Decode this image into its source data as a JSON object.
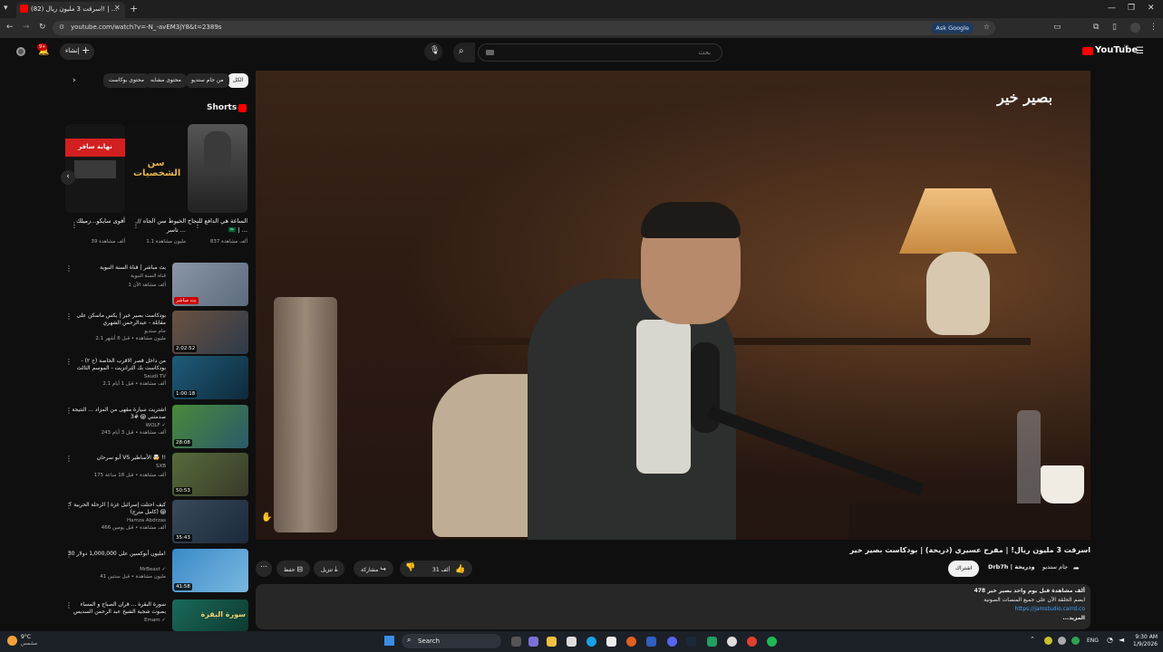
{
  "browser": {
    "tab_title": "(82) اسرقت 3 مليون ريال! | ...",
    "url": "youtube.com/watch?v=-N_-avEM3jY8&t=2389s",
    "ask_google": "Ask Google"
  },
  "header": {
    "logo": "YouTube",
    "logo_sup": "SA",
    "search_placeholder": "بحث",
    "create_label": "إنشاء",
    "notifications_count": "9+"
  },
  "filter_chips": [
    "الكل",
    "من جام ستديو",
    "محتوى مشابه",
    "محتوى بوكاست"
  ],
  "shorts": {
    "heading": "Shorts",
    "items": [
      {
        "title": "الساعة هي الدافع للنجاح 🇸🇦 | ...",
        "views": "837 ألف مشاهدة"
      },
      {
        "title": "الخيوط سن الجاه // تاسر ...",
        "views": "1.1 مليون مشاهدة",
        "overlay": "سن الشخصيات"
      },
      {
        "title": "أقوى سايكو...زميلك",
        "views": "39 ألف مشاهدة",
        "overlay": "نهاية سافر"
      }
    ]
  },
  "related": [
    {
      "title": "بث مباشر | قناة السنة النبوية",
      "channel": "قناة السنة النبوية",
      "meta": "1 ألف مشاهد الآن",
      "duration": "بث مباشر"
    },
    {
      "title": "بودكاست بصير خير | يكس ماسكن على مقابلة - عبدالرحمن الشهري",
      "channel": "جام ستديو",
      "meta": "2.1 مليون مشاهدة • قبل 6 أشهر",
      "duration": "2:02:52"
    },
    {
      "title": "من داخل قصر الاقرب الخاصة (ح ٢) - بودكاست بك الترانزيت - الموسم الثالث",
      "channel": "Saudi TV",
      "meta": "2.1 ألف مشاهدة • قبل 1 أيام",
      "duration": "1:00:18"
    },
    {
      "title": "اشتريت سيارة مقهى من المزاد ... النتيجة صدمتني 😱 #3",
      "channel": "WOLF ✓",
      "meta": "243 ألف مشاهدة • قبل 3 أيام",
      "duration": "28:08"
    },
    {
      "title": "أبو سرحان VS الأساطير 🤯 !!",
      "channel": "SXB",
      "meta": "175 ألف مشاهدة • قبل 18 ساعة",
      "duration": "50:53"
    },
    {
      "title": "كيف احتلت إسرائيل غزة | الرحلة الحربية ؟ (كامل مترج) 😱",
      "channel": "Hamza Abdrzas",
      "meta": "466 ألف مشاهدة • قبل يومين",
      "duration": "35:43"
    },
    {
      "title": "30 مليون أبوكسين على 1,000,000 دولار!",
      "channel": "MrBeast ✓",
      "meta": "41 مليون مشاهدة • قبل سنتين",
      "duration": "41:58"
    },
    {
      "title": "سورة البقرة ... قران الصباح و المساء بصوت شجبة الشيخ عبد الرحمن السديس",
      "channel": "Emam ✓",
      "meta": "",
      "duration": "سورة البقرة"
    }
  ],
  "video": {
    "title": "اسرقت 3 مليون ريال! | مفرح عسيري (دريخة) | بودكاست بصير خير",
    "channel": "جام ستديو",
    "channel2": "Drb7h | ودريخة",
    "subscribe": "اشتراك",
    "likes": "31 ألف",
    "share": "مشاركة",
    "download": "تنزيل",
    "save": "حفظ",
    "watermark": "بصير خير",
    "description": {
      "stats": "478 ألف مشاهدة  قبل يوم واحد  بصير خير",
      "line1": "ابضم الحلقة الآن على جميع المنصات الصوتية",
      "link": "https://jamstudio.carrd.co",
      "more": "...المزيد"
    }
  },
  "taskbar": {
    "weather_temp": "9°C",
    "weather_desc": "مشمس",
    "search_label": "Search",
    "lang": "ENG",
    "time": "9:30 AM",
    "date": "1/9/2026"
  }
}
